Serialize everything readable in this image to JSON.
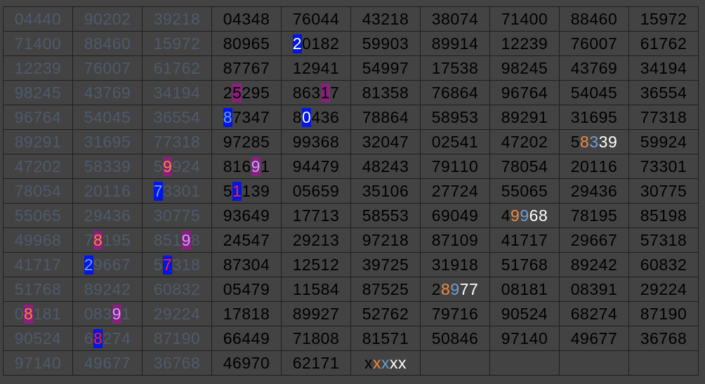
{
  "colors": {
    "background": "#434343",
    "number_text": "#000000",
    "dim_text": "#4e5a6c",
    "highlight_blue": "#0015e8",
    "highlight_purple": "#8a1f7c",
    "digit_orange": "#f08a3c",
    "digit_blue": "#6c9fd6",
    "digit_white": "#ffffff",
    "digit_red": "#ff2222",
    "digit_lavender": "#b8a9ff"
  },
  "grid": {
    "dim_columns": 3,
    "rows": [
      [
        "04440",
        "90202",
        "39218",
        "04348",
        "76044",
        "43218",
        "38074",
        "71400",
        "88460",
        "15972"
      ],
      [
        "71400",
        "88460",
        "15972",
        "80965",
        "20182",
        "59903",
        "89914",
        "12239",
        "76007",
        "61762"
      ],
      [
        "12239",
        "76007",
        "61762",
        "87767",
        "12941",
        "54997",
        "17538",
        "98245",
        "43769",
        "34194"
      ],
      [
        "98245",
        "43769",
        "34194",
        "25295",
        "86317",
        "81358",
        "76864",
        "96764",
        "54045",
        "36554"
      ],
      [
        "96764",
        "54045",
        "36554",
        "87347",
        "80436",
        "78864",
        "58953",
        "89291",
        "31695",
        "77318"
      ],
      [
        "89291",
        "31695",
        "77318",
        "97285",
        "99368",
        "32047",
        "02541",
        "47202",
        "58339",
        "59924"
      ],
      [
        "47202",
        "58339",
        "59924",
        "81691",
        "94479",
        "48243",
        "79110",
        "78054",
        "20116",
        "73301"
      ],
      [
        "78054",
        "20116",
        "73301",
        "51139",
        "05659",
        "35106",
        "27724",
        "55065",
        "29436",
        "30775"
      ],
      [
        "55065",
        "29436",
        "30775",
        "93649",
        "17713",
        "58553",
        "69049",
        "49968",
        "78195",
        "85198"
      ],
      [
        "49968",
        "78195",
        "85198",
        "24547",
        "29213",
        "97218",
        "87109",
        "41717",
        "29667",
        "57318"
      ],
      [
        "41717",
        "29667",
        "57318",
        "87304",
        "12512",
        "39725",
        "31918",
        "51768",
        "89242",
        "60832"
      ],
      [
        "51768",
        "89242",
        "60832",
        "05479",
        "11584",
        "87525",
        "28977",
        "08181",
        "08391",
        "29224"
      ],
      [
        "08181",
        "08391",
        "29224",
        "17818",
        "89927",
        "52762",
        "79716",
        "90524",
        "68274",
        "87190"
      ],
      [
        "90524",
        "68274",
        "87190",
        "66449",
        "71808",
        "81571",
        "50846",
        "97140",
        "49677",
        "36768"
      ],
      [
        "97140",
        "49677",
        "36768",
        "46970",
        "62171",
        "xxxxx",
        "",
        "",
        "",
        ""
      ]
    ]
  },
  "highlights": [
    {
      "row": 1,
      "col": 4,
      "digit": 0,
      "bg": "blue",
      "fg": "white"
    },
    {
      "row": 3,
      "col": 3,
      "digit": 1,
      "bg": "purple",
      "fg": "black"
    },
    {
      "row": 3,
      "col": 4,
      "digit": 3,
      "bg": "purple",
      "fg": "black"
    },
    {
      "row": 4,
      "col": 3,
      "digit": 0,
      "bg": "blue",
      "fg": "blue"
    },
    {
      "row": 4,
      "col": 4,
      "digit": 1,
      "bg": "blue",
      "fg": "white"
    },
    {
      "row": 5,
      "col": 8,
      "digit": 1,
      "fg": "orange"
    },
    {
      "row": 5,
      "col": 8,
      "digit": 2,
      "fg": "blue"
    },
    {
      "row": 5,
      "col": 8,
      "digit": 3,
      "fg": "white"
    },
    {
      "row": 5,
      "col": 8,
      "digit": 4,
      "fg": "white"
    },
    {
      "row": 6,
      "col": 2,
      "digit": 1,
      "bg": "purple",
      "fg": "orange"
    },
    {
      "row": 6,
      "col": 3,
      "digit": 3,
      "bg": "purple",
      "fg": "lav"
    },
    {
      "row": 7,
      "col": 2,
      "digit": 0,
      "bg": "blue",
      "fg": "blue"
    },
    {
      "row": 7,
      "col": 3,
      "digit": 1,
      "bg": "blue",
      "fg": "red"
    },
    {
      "row": 8,
      "col": 7,
      "digit": 1,
      "fg": "orange"
    },
    {
      "row": 8,
      "col": 7,
      "digit": 2,
      "fg": "blue"
    },
    {
      "row": 8,
      "col": 7,
      "digit": 3,
      "fg": "white"
    },
    {
      "row": 8,
      "col": 7,
      "digit": 4,
      "fg": "white"
    },
    {
      "row": 9,
      "col": 1,
      "digit": 1,
      "bg": "purple",
      "fg": "orange"
    },
    {
      "row": 9,
      "col": 2,
      "digit": 3,
      "bg": "purple",
      "fg": "lav"
    },
    {
      "row": 10,
      "col": 1,
      "digit": 0,
      "bg": "blue",
      "fg": "blue"
    },
    {
      "row": 10,
      "col": 2,
      "digit": 1,
      "bg": "blue",
      "fg": "red"
    },
    {
      "row": 11,
      "col": 6,
      "digit": 1,
      "fg": "orange"
    },
    {
      "row": 11,
      "col": 6,
      "digit": 2,
      "fg": "blue"
    },
    {
      "row": 11,
      "col": 6,
      "digit": 3,
      "fg": "white"
    },
    {
      "row": 11,
      "col": 6,
      "digit": 4,
      "fg": "white"
    },
    {
      "row": 12,
      "col": 0,
      "digit": 1,
      "bg": "purple",
      "fg": "orange"
    },
    {
      "row": 12,
      "col": 1,
      "digit": 3,
      "bg": "purple",
      "fg": "lav"
    },
    {
      "row": 13,
      "col": 1,
      "digit": 1,
      "bg": "blue",
      "fg": "red"
    },
    {
      "row": 14,
      "col": 5,
      "digit": 1,
      "fg": "orange"
    },
    {
      "row": 14,
      "col": 5,
      "digit": 2,
      "fg": "blue"
    },
    {
      "row": 14,
      "col": 5,
      "digit": 3,
      "fg": "white"
    },
    {
      "row": 14,
      "col": 5,
      "digit": 4,
      "fg": "white"
    }
  ]
}
